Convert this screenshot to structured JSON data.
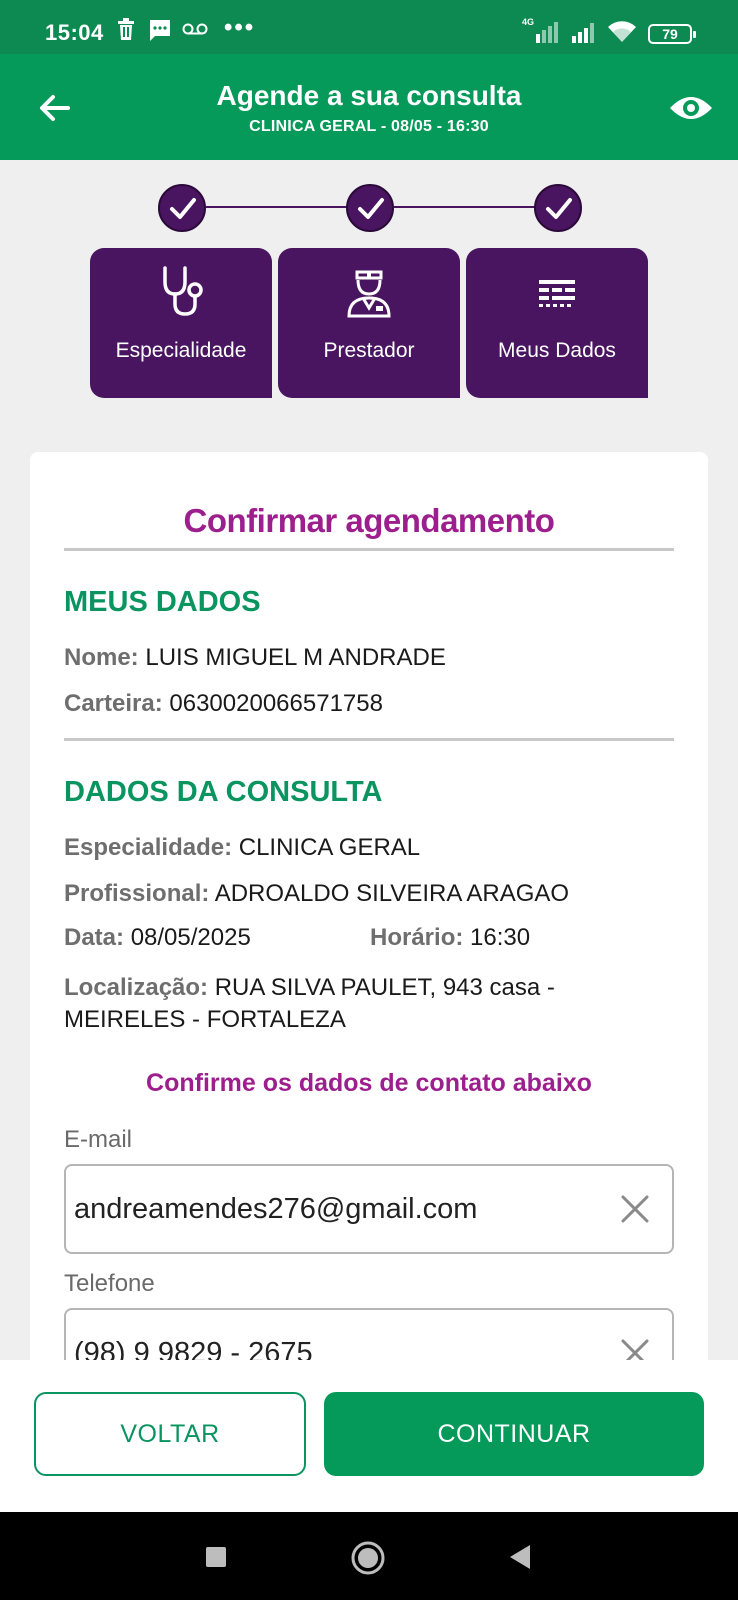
{
  "status_bar": {
    "time": "15:04",
    "dots": "•••",
    "network_label": "4G",
    "battery": "79"
  },
  "header": {
    "title": "Agende a sua consulta",
    "subtitle": "CLINICA GERAL - 08/05 - 16:30"
  },
  "steps": [
    {
      "label": "Especialidade",
      "icon": "stethoscope-icon",
      "done": true
    },
    {
      "label": "Prestador",
      "icon": "doctor-icon",
      "done": true
    },
    {
      "label": "Meus Dados",
      "icon": "data-icon",
      "done": true
    }
  ],
  "card": {
    "title": "Confirmar agendamento",
    "my_data": {
      "heading": "MEUS DADOS",
      "name_label": "Nome:",
      "name_value": "LUIS MIGUEL M ANDRADE",
      "card_label": "Carteira:",
      "card_value": "0630020066571758"
    },
    "appointment": {
      "heading": "DADOS DA CONSULTA",
      "specialty_label": "Especialidade:",
      "specialty_value": "CLINICA GERAL",
      "professional_label": "Profissional:",
      "professional_value": "ADROALDO SILVEIRA ARAGAO",
      "date_label": "Data:",
      "date_value": "08/05/2025",
      "time_label": "Horário:",
      "time_value": "16:30",
      "location_label": "Localização:",
      "location_value_line1": "RUA SILVA PAULET, 943 casa -",
      "location_value_line2": "MEIRELES - FORTALEZA"
    },
    "contact": {
      "heading": "Confirme os dados de contato abaixo",
      "email_label": "E-mail",
      "email_value": "andreamendes276@gmail.com",
      "phone_label": "Telefone",
      "phone_value": "(98) 9 9829 - 2675"
    }
  },
  "buttons": {
    "back": "VOLTAR",
    "continue": "CONTINUAR"
  },
  "colors": {
    "primary_green": "#069a5a",
    "purple": "#4a1560",
    "magenta": "#9c1f8d"
  }
}
